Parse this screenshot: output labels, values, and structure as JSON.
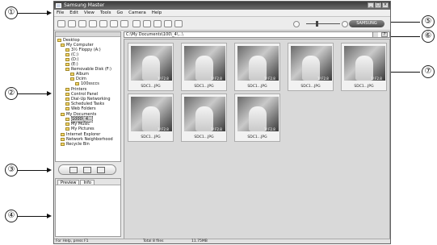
{
  "window": {
    "title": "Samsung Master"
  },
  "menu": [
    "File",
    "Edit",
    "View",
    "Tools",
    "Go",
    "Camera",
    "Help"
  ],
  "brand": "SAMSUNG",
  "path": "C:\\My Documents\\100\\_4\\...\\",
  "help_label": "?",
  "tree": [
    "Desktop",
    "My Computer",
    "3½ Floppy (A:)",
    "(C:)",
    "(D:)",
    "(E:)",
    "Removable Disk (F:)",
    "Album",
    "Dcim",
    "100ssccs",
    "Printers",
    "Control Panel",
    "Dial-Up Networking",
    "Scheduled Tasks",
    "Web Folders",
    "My Documents",
    "1000\\_4...",
    "My Music",
    "My Pictures",
    "Internet Explorer",
    "Network Neighborhood",
    "Recycle Bin"
  ],
  "prop_tabs": [
    "Preview",
    "Info"
  ],
  "thumbnails": [
    {
      "name": "SDC1...JPG",
      "badge": "1/ F2.8"
    },
    {
      "name": "SDC1...JPG",
      "badge": "1/ F2.8"
    },
    {
      "name": "SDC1...JPG",
      "badge": "1/ F2.8"
    },
    {
      "name": "SDC1...JPG",
      "badge": "1/ F2.8"
    },
    {
      "name": "SDC1...JPG",
      "badge": "1/ F2.8"
    },
    {
      "name": "SDC1...JPG",
      "badge": "1/ F2.8"
    },
    {
      "name": "SDC1...JPG",
      "badge": "1/ F2.8"
    },
    {
      "name": "SDC1...JPG",
      "badge": "1/ F2.8"
    }
  ],
  "status": {
    "help": "For Help, press F1",
    "total": "Total 8 files",
    "size": "11.75MB"
  },
  "callouts": [
    "①",
    "②",
    "③",
    "④",
    "⑤",
    "⑥",
    "⑦"
  ]
}
